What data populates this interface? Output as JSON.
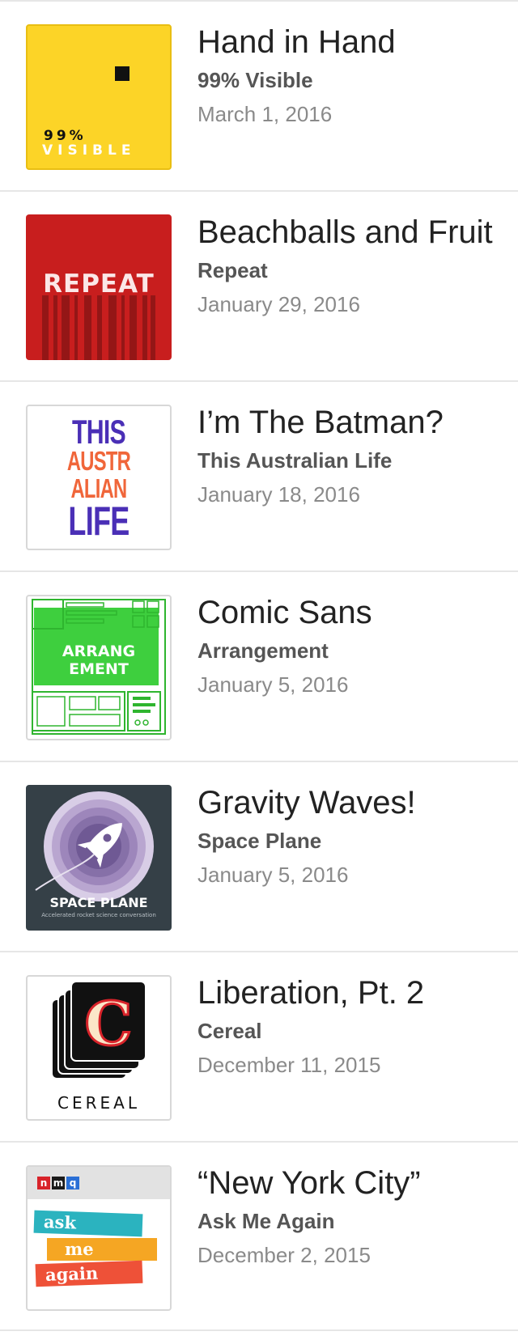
{
  "episodes": [
    {
      "title": "Hand in Hand",
      "show": "99% Visible",
      "date": "March 1, 2016",
      "art": {
        "line1": "99%",
        "line2": "VISIBLE",
        "color": "#fcd427"
      }
    },
    {
      "title": "Beachballs and Fruit",
      "show": "Repeat",
      "date": "January 29, 2016",
      "art": {
        "word": "REPEAT",
        "color": "#c81e1e"
      }
    },
    {
      "title": "I’m The Batman?",
      "show": "This Australian Life",
      "date": "January 18, 2016",
      "art": {
        "lines": [
          "THIS",
          "AUSTR",
          "ALIAN",
          "LIFE"
        ]
      }
    },
    {
      "title": "Comic Sans",
      "show": "Arrangement",
      "date": "January 5, 2016",
      "art": {
        "line1": "ARRANG",
        "line2": "EMENT",
        "color": "#3ecf3e"
      }
    },
    {
      "title": "Gravity Waves!",
      "show": "Space Plane",
      "date": "January 5, 2016",
      "art": {
        "title": "SPACE PLANE",
        "subtitle": "Accelerated rocket science conversation",
        "color": "#354047"
      }
    },
    {
      "title": "Liberation, Pt. 2",
      "show": "Cereal",
      "date": "December 11, 2015",
      "art": {
        "letter": "C",
        "word": "CEREAL"
      }
    },
    {
      "title": "“New York City”",
      "show": "Ask Me Again",
      "date": "December 2, 2015",
      "art": {
        "logo": [
          "n",
          "m",
          "q"
        ],
        "words": [
          "ask",
          "me",
          "again"
        ]
      }
    }
  ]
}
